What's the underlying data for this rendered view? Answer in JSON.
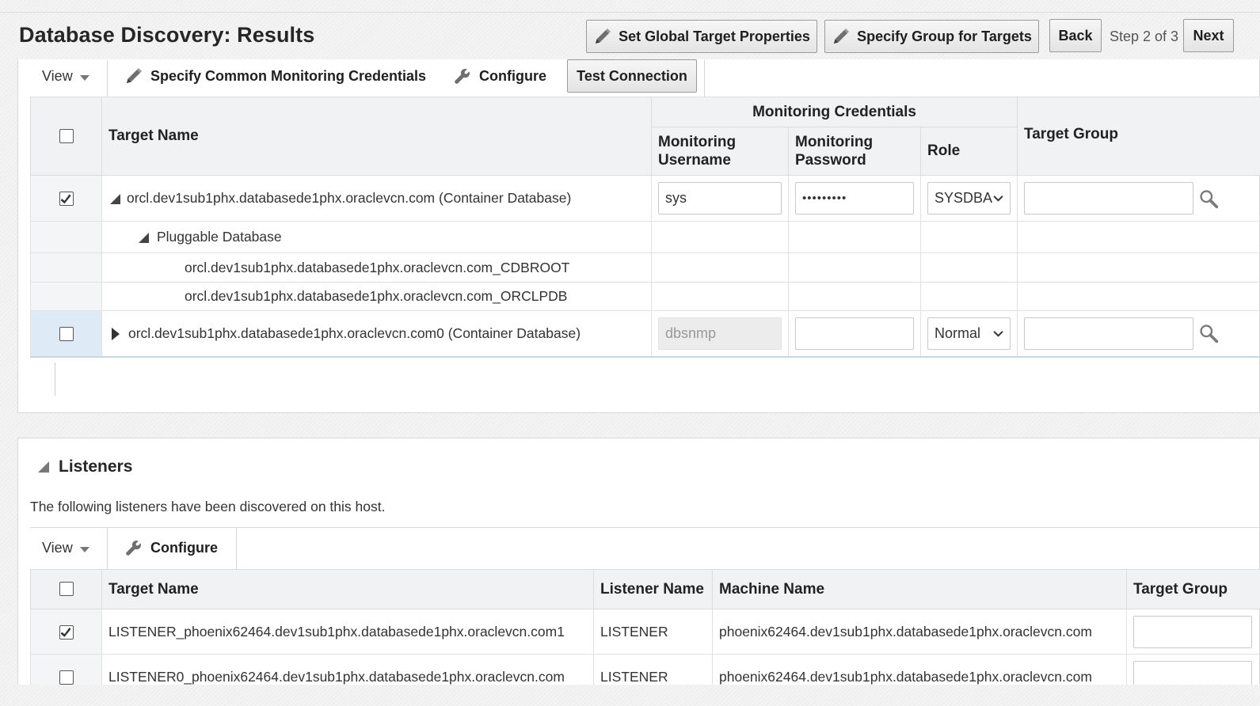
{
  "page": {
    "title": "Database Discovery: Results"
  },
  "header": {
    "set_global_label": "Set Global Target Properties",
    "specify_group_label": "Specify Group for Targets",
    "back_label": "Back",
    "step_text": "Step 2 of 3",
    "next_label": "Next"
  },
  "db_toolbar": {
    "view_label": "View",
    "specify_creds_label": "Specify Common Monitoring Credentials",
    "configure_label": "Configure",
    "test_connection_label": "Test Connection"
  },
  "db_table": {
    "headers": {
      "target_name": "Target Name",
      "monitoring_credentials": "Monitoring Credentials",
      "monitoring_username": "Monitoring Username",
      "monitoring_password": "Monitoring Password",
      "role": "Role",
      "target_group": "Target Group"
    },
    "rows": [
      {
        "checked": true,
        "name": "orcl.dev1sub1phx.databasede1phx.oraclevcn.com (Container Database)",
        "username": "sys",
        "password": "•••••••••",
        "role": "SYSDBA"
      },
      {
        "label": "Pluggable Database"
      },
      {
        "name": "orcl.dev1sub1phx.databasede1phx.oraclevcn.com_CDBROOT"
      },
      {
        "name": "orcl.dev1sub1phx.databasede1phx.oraclevcn.com_ORCLPDB"
      },
      {
        "checked": false,
        "name": "orcl.dev1sub1phx.databasede1phx.oraclevcn.com0 (Container Database)",
        "username": "dbsnmp",
        "password": "",
        "role": "Normal"
      }
    ]
  },
  "listeners": {
    "title": "Listeners",
    "description": "The following listeners have been discovered on this host.",
    "toolbar": {
      "view_label": "View",
      "configure_label": "Configure"
    },
    "headers": {
      "target_name": "Target Name",
      "listener_name": "Listener Name",
      "machine_name": "Machine Name",
      "target_group": "Target Group"
    },
    "rows": [
      {
        "checked": true,
        "target_name": "LISTENER_phoenix62464.dev1sub1phx.databasede1phx.oraclevcn.com1",
        "listener_name": "LISTENER",
        "machine_name": "phoenix62464.dev1sub1phx.databasede1phx.oraclevcn.com"
      },
      {
        "checked": false,
        "target_name": "LISTENER0_phoenix62464.dev1sub1phx.databasede1phx.oraclevcn.com",
        "listener_name": "LISTENER",
        "machine_name": "phoenix62464.dev1sub1phx.databasede1phx.oraclevcn.com"
      }
    ]
  }
}
